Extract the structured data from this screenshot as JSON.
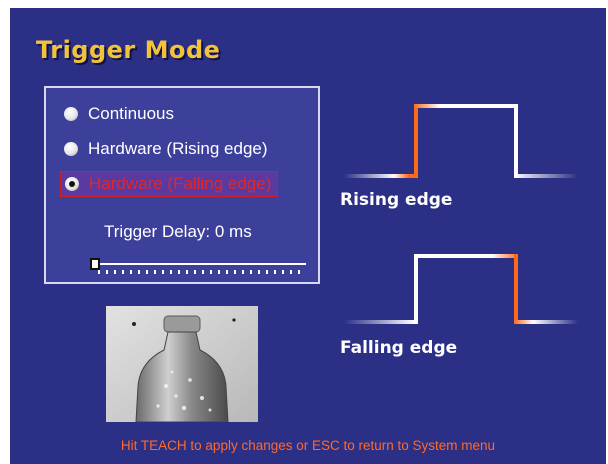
{
  "screen": {
    "title": "Trigger Mode",
    "footer": "Hit TEACH to apply changes or ESC to return to System menu"
  },
  "trigger_options": [
    {
      "label": "Continuous",
      "checked": false
    },
    {
      "label": "Hardware (Rising edge)",
      "checked": false
    },
    {
      "label": "Hardware (Falling edge)",
      "checked": true
    }
  ],
  "delay": {
    "label": "Trigger Delay: 0 ms",
    "value_ms": 0,
    "slider_fraction": 0
  },
  "waveforms": {
    "rising_label": "Rising edge",
    "falling_label": "Falling edge",
    "highlight_color": "#ff6a1a",
    "line_color": "#ffffff"
  },
  "colors": {
    "background": "#2b2f86",
    "title": "#f2c23a",
    "selected_text": "#e0262a",
    "footer": "#ff6a2a"
  },
  "camera_preview": {
    "icon": "bottle-camera-image"
  }
}
